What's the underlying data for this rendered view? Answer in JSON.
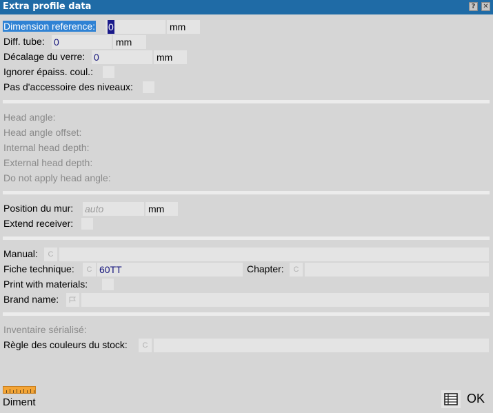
{
  "window": {
    "title": "Extra profile data",
    "help_label": "?",
    "close_label": "✕"
  },
  "section1": {
    "dimension_reference": {
      "label": "Dimension reference:",
      "value": "0",
      "unit": "mm"
    },
    "diff_tube": {
      "label": "Diff. tube:",
      "value": "0",
      "unit": "mm"
    },
    "decalage": {
      "label": "Décalage du verre:",
      "value": "0",
      "unit": "mm"
    },
    "ignorer": {
      "label": "Ignorer épaiss. coul.:"
    },
    "pas_accessoire": {
      "label": "Pas d'accessoire des niveaux:"
    }
  },
  "section2": {
    "head_angle": "Head angle:",
    "head_angle_offset": "Head angle offset:",
    "internal_head_depth": "Internal head depth:",
    "external_head_depth": "External head depth:",
    "do_not_apply": "Do not apply head angle:"
  },
  "section3": {
    "position_mur": {
      "label": "Position du mur:",
      "placeholder": "auto",
      "unit": "mm"
    },
    "extend_receiver": {
      "label": "Extend receiver:"
    }
  },
  "section4": {
    "manual": {
      "label": "Manual:",
      "c": "C",
      "value": ""
    },
    "fiche_technique": {
      "label": "Fiche technique:",
      "c": "C",
      "value": "60TT"
    },
    "chapter": {
      "label": "Chapter:",
      "c": "C",
      "value": ""
    },
    "print_materials": {
      "label": "Print with materials:"
    },
    "brand_name": {
      "label": "Brand name:",
      "value": ""
    }
  },
  "section5": {
    "inventaire": "Inventaire sérialisé:",
    "regle_couleurs": {
      "label": "Règle des couleurs du stock:",
      "c": "C",
      "value": ""
    }
  },
  "footer": {
    "diment_label": "Diment",
    "ok_label": "OK"
  },
  "colors": {
    "titlebar": "#1f6ba6",
    "selection": "#2f82d4",
    "ruler": "#f4a536"
  }
}
